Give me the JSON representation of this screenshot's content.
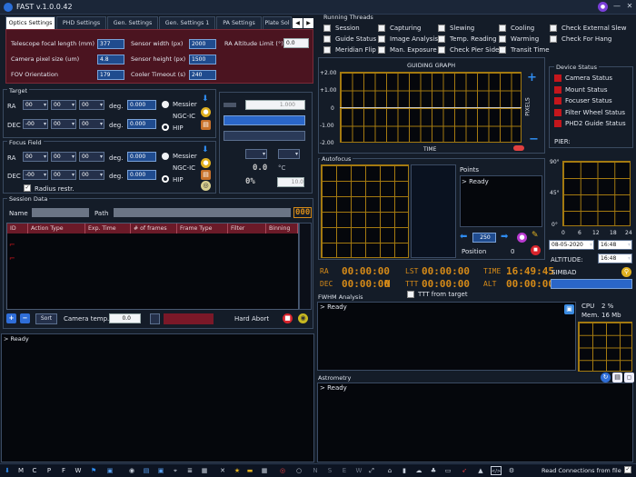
{
  "app": {
    "title": "FAST v.1.0.0.42",
    "win_min": "—",
    "win_max": "□",
    "win_close": "✕"
  },
  "tabs": [
    "Optics Settings",
    "PHD Settings",
    "Gen. Settings",
    "Gen. Settings 1",
    "PA Settings",
    "Plate Sol"
  ],
  "optics": {
    "focal_label": "Telescope focal length (mm)",
    "focal_val": "377",
    "pixel_label": "Camera pixel size (um)",
    "pixel_val": "4.8",
    "fov_label": "FOV Orientation",
    "fov_val": "179",
    "sw_label": "Sensor width (px)",
    "sw_val": "2000",
    "sh_label": "Sensor height (px)",
    "sh_val": "1500",
    "cool_label": "Cooler Timeout (s)",
    "cool_val": "240",
    "alt_label": "RA Altitude Limit (°)",
    "alt_val": "0.0"
  },
  "target": {
    "title": "Target",
    "ra": "RA",
    "dec": "DEC",
    "deg": "deg.",
    "dd": "00",
    "dec_dd": "-00",
    "val": "0.000",
    "messier": "Messier",
    "ngcic": "NGC-IC",
    "hip": "HIP"
  },
  "focus": {
    "title": "Focus Field",
    "ra": "RA",
    "dec": "DEC",
    "deg": "deg.",
    "dd": "00",
    "dec_dd": "-00",
    "val": "0.000",
    "messier": "Messier",
    "ngcic": "NGC-IC",
    "hip": "HIP",
    "radius": "Radius restr."
  },
  "middle": {
    "v1": "1.000",
    "temp": "0.0",
    "c": "°C",
    "percent": "0%",
    "v2": "10.0"
  },
  "session": {
    "title": "Session Data",
    "name": "Name",
    "path": "Path",
    "counter": "000",
    "columns": [
      "ID",
      "Action Type",
      "Exp. Time",
      "# of frames",
      "Frame Type",
      "Filter",
      "Binning"
    ],
    "sort": "Sort",
    "cam_temp": "Camera temp.",
    "cam_temp_val": "0.0",
    "hard_abort": "Hard Abort"
  },
  "log_main": "> Ready",
  "threads": {
    "title": "Running Threads",
    "items": [
      "Session",
      "Guide Status",
      "Meridian Flip",
      "Capturing",
      "Image Analysis",
      "Man. Exposure",
      "Slewing",
      "Temp. Reading",
      "Check Pier Side",
      "Cooling",
      "Warming",
      "Transit Time",
      "Check External Slew",
      "Check For Hang"
    ]
  },
  "guiding": {
    "title": "GUIDING GRAPH",
    "yticks": [
      "+2.00",
      "+1.00",
      "0",
      "-1.00",
      "-2.00"
    ],
    "xlabel": "TIME",
    "ylabel": "PIXELS"
  },
  "device": {
    "title": "Device Status",
    "items": [
      "Camera Status",
      "Mount Status",
      "Focuser Status",
      "Filter Wheel Status",
      "PHD2 Guide Status"
    ],
    "pier": "PIER:"
  },
  "autofocus": {
    "title": "Autofocus",
    "points": "Points",
    "log": "> Ready",
    "step": "250",
    "position": "Position",
    "pos_val": "0"
  },
  "altaz": {
    "yticks": [
      "90°",
      "45°",
      "0°"
    ],
    "xticks": [
      "0",
      "6",
      "12",
      "18",
      "24"
    ],
    "date": "08-05-2020",
    "time": "16:48",
    "altitude": "ALTITUDE:",
    "alt_time": "16:48"
  },
  "coords": {
    "ra": "RA",
    "dec": "DEC",
    "lst": "LST",
    "ttt": "TTT",
    "time_lbl": "TIME",
    "alt": "ALT",
    "ra_val": "00:00:00",
    "dec_val": "00:00:00",
    "n": "N",
    "lst_val": "00:00:00",
    "ttt_val": "00:00:00",
    "time_val": "16:49:45",
    "alt_val": "00:00:00",
    "ttt_target": "TTT from target"
  },
  "simbad": "SIMBAD",
  "fwhm": {
    "title": "FWHM Analysis",
    "log": "> Ready"
  },
  "sys": {
    "cpu": "CPU",
    "cpu_val": "2 %",
    "mem": "Mem.",
    "mem_val": "16 Mb"
  },
  "astro": {
    "title": "Astrometry",
    "log": "> Ready"
  },
  "taskbar": {
    "letters": [
      "M",
      "C",
      "P",
      "F",
      "W"
    ],
    "nsew": [
      "N",
      "S",
      "E",
      "W"
    ],
    "read_conn": "Read Connections from file"
  },
  "colors": {
    "accent": "#d58a18",
    "maroon": "#4b1420",
    "blue": "#1f4b8e",
    "red": "#c4161c"
  }
}
